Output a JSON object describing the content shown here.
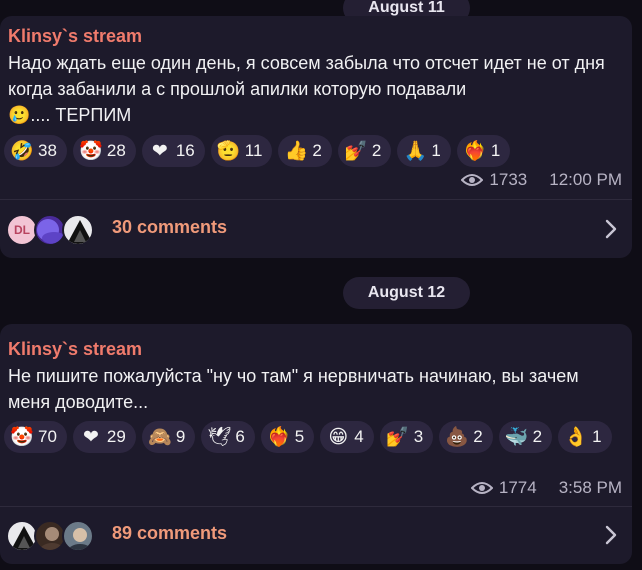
{
  "posts": [
    {
      "date": "August 11",
      "author": "Klinsy`s stream",
      "message": "Надо ждать еще один день, я совсем забыла что отсчет идет не от дня когда забанили а с прошлой апилки которую подавали",
      "message_emoji": "🥲",
      "message_tail": ".... ТЕРПИМ",
      "reactions": [
        {
          "emoji": "🤣",
          "icon": "rofl-icon",
          "count": "38"
        },
        {
          "emoji": "🤡",
          "icon": "clown-icon",
          "count": "28"
        },
        {
          "emoji": "❤",
          "icon": "heart-icon",
          "count": "16"
        },
        {
          "emoji": "🫡",
          "icon": "pointing-hand-icon",
          "count": "11"
        },
        {
          "emoji": "👍",
          "icon": "thumbs-up-icon",
          "count": "2"
        },
        {
          "emoji": "💅",
          "icon": "nail-polish-icon",
          "count": "2"
        },
        {
          "emoji": "🙏",
          "icon": "pray-icon",
          "count": "1"
        },
        {
          "emoji": "❤‍🔥",
          "icon": "heart-on-fire-icon",
          "count": "1"
        }
      ],
      "views": "1733",
      "time": "12:00 PM",
      "comments_label": "30 comments",
      "avatar_initials": "DL"
    },
    {
      "date": "August 12",
      "author": "Klinsy`s stream",
      "message": "Не пишите пожалуйста \"ну чо там\" я нервничать начинаю, вы зачем меня доводите...",
      "reactions": [
        {
          "emoji": "🤡",
          "icon": "clown-icon",
          "count": "70"
        },
        {
          "emoji": "❤",
          "icon": "heart-icon",
          "count": "29"
        },
        {
          "emoji": "🙈",
          "icon": "see-no-evil-monkey-icon",
          "count": "9"
        },
        {
          "emoji": "🕊",
          "icon": "dove-icon",
          "count": "6"
        },
        {
          "emoji": "❤‍🔥",
          "icon": "heart-on-fire-icon",
          "count": "5"
        },
        {
          "emoji": "😁",
          "icon": "grin-icon",
          "count": "4"
        },
        {
          "emoji": "💅",
          "icon": "nail-polish-icon",
          "count": "3"
        },
        {
          "emoji": "💩",
          "icon": "poop-icon",
          "count": "2"
        },
        {
          "emoji": "🐳",
          "icon": "whale-icon",
          "count": "2"
        },
        {
          "emoji": "👌",
          "icon": "ok-hand-icon",
          "count": "1"
        }
      ],
      "views": "1774",
      "time": "3:58 PM",
      "comments_label": "89 comments"
    }
  ],
  "colors": {
    "background": "#0f0d16",
    "post_background": "#1d1a2b",
    "author": "#f07b6c",
    "comments_link": "#f09a7a",
    "reaction_pill": "#2d2740"
  }
}
